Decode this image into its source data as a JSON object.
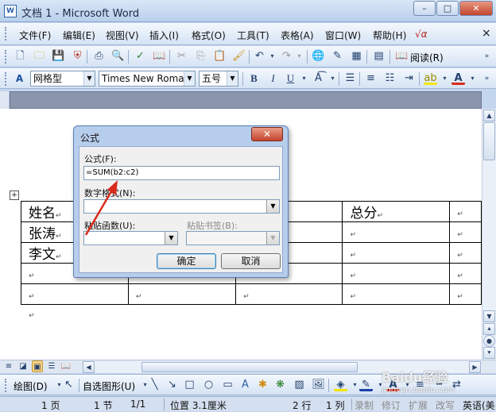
{
  "window": {
    "title": "文档 1 - Microsoft Word",
    "app_icon": "W",
    "min": "–",
    "max": "□",
    "close": "✕"
  },
  "menu": {
    "items": [
      "文件(F)",
      "编辑(E)",
      "视图(V)",
      "插入(I)",
      "格式(O)",
      "工具(T)",
      "表格(A)",
      "窗口(W)",
      "帮助(H)"
    ],
    "formula_icon": "√α",
    "close_doc": "×"
  },
  "toolbar_standard": {
    "read_label": "阅读(R)"
  },
  "toolbar_format": {
    "style": "网格型",
    "font": "Times New Roman",
    "size": "五号",
    "bold": "B",
    "italic": "I",
    "underline": "U"
  },
  "table": {
    "rows": [
      [
        "姓名",
        "",
        "",
        "总分",
        ""
      ],
      [
        "张涛",
        "",
        "",
        "",
        ""
      ],
      [
        "李文",
        "",
        "",
        "",
        ""
      ],
      [
        "",
        "",
        "",
        "",
        ""
      ],
      [
        "",
        "",
        "",
        "",
        ""
      ]
    ],
    "cell_mark": "↵",
    "anchor": "+"
  },
  "dialog": {
    "title": "公式",
    "close": "✕",
    "formula_label": "公式(F):",
    "formula_value": "=SUM(b2:c2)",
    "number_format_label": "数字格式(N):",
    "number_format_value": "",
    "paste_function_label": "粘贴函数(U):",
    "paste_function_value": "",
    "paste_bookmark_label": "粘贴书签(B):",
    "paste_bookmark_value": "",
    "ok": "确定",
    "cancel": "取消"
  },
  "drawbar": {
    "draw_label": "绘图(D)",
    "autoshapes_label": "自选图形(U)"
  },
  "status": {
    "page": "1 页",
    "section": "1 节",
    "page_of": "1/1",
    "position": "位置 3.1厘米",
    "line": "2 行",
    "column": "1 列",
    "rec": "录制",
    "trk": "修订",
    "ext": "扩展",
    "ovr": "改写",
    "lang": "英语(美"
  },
  "watermark": {
    "text": "Baidu经验",
    "sub": "jingyan.baidu.com"
  },
  "colors": {
    "accent": "#d92a1c",
    "menubar": "#d5e3f4",
    "window_bg": "#c4d6ee"
  }
}
